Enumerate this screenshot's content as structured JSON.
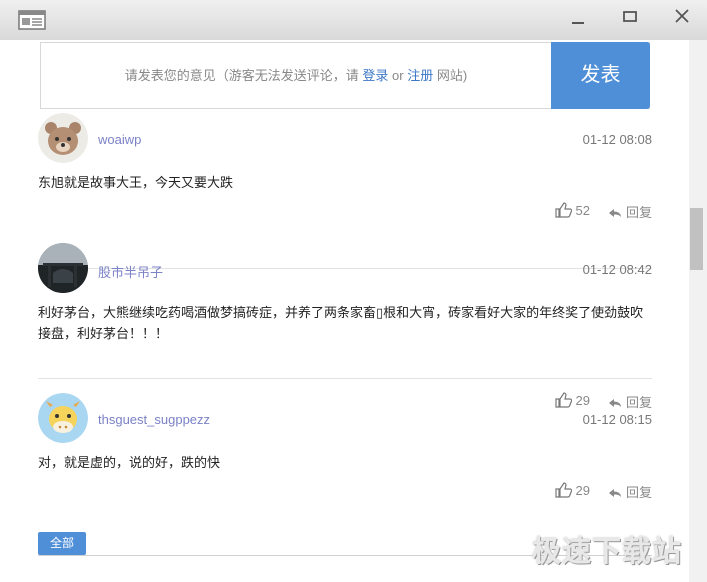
{
  "window": {
    "icon": "newspaper-icon",
    "controls": [
      "minimize-icon",
      "maximize-icon",
      "close-icon"
    ]
  },
  "comment_input": {
    "placeholder_prefix": "请发表您的意见（游客无法发送评论，请",
    "login_link": "登录",
    "or_text": "or",
    "register_link": "注册",
    "placeholder_suffix": "网站)",
    "submit_label": "发表"
  },
  "comments": [
    {
      "username": "woaiwp",
      "time": "01-12 08:08",
      "text": "东旭就是故事大王，今天又要大跌",
      "likes": "52",
      "reply_label": "回复",
      "avatar": "bear-avatar"
    },
    {
      "username": "股市半吊子",
      "time": "01-12 08:42",
      "text": "利好茅台，大熊继续吃药喝酒做梦搞砖症，并养了两条家畜▯根和大宵，砖家看好大家的年终奖了使劲鼓吹接盘，利好茅台！！！",
      "likes": "29",
      "reply_label": "回复",
      "avatar": "photo-avatar"
    },
    {
      "username": "thsguest_sugppezz",
      "time": "01-12 08:15",
      "text": "对，就是虚的，说的好，跌的快",
      "likes": "29",
      "reply_label": "回复",
      "avatar": "cow-avatar"
    }
  ],
  "tabs": {
    "all_label": "全部"
  },
  "watermark": "极速下载站",
  "colors": {
    "accent": "#4f8fd8",
    "username": "#7b82c7",
    "link": "#3d78c6"
  }
}
